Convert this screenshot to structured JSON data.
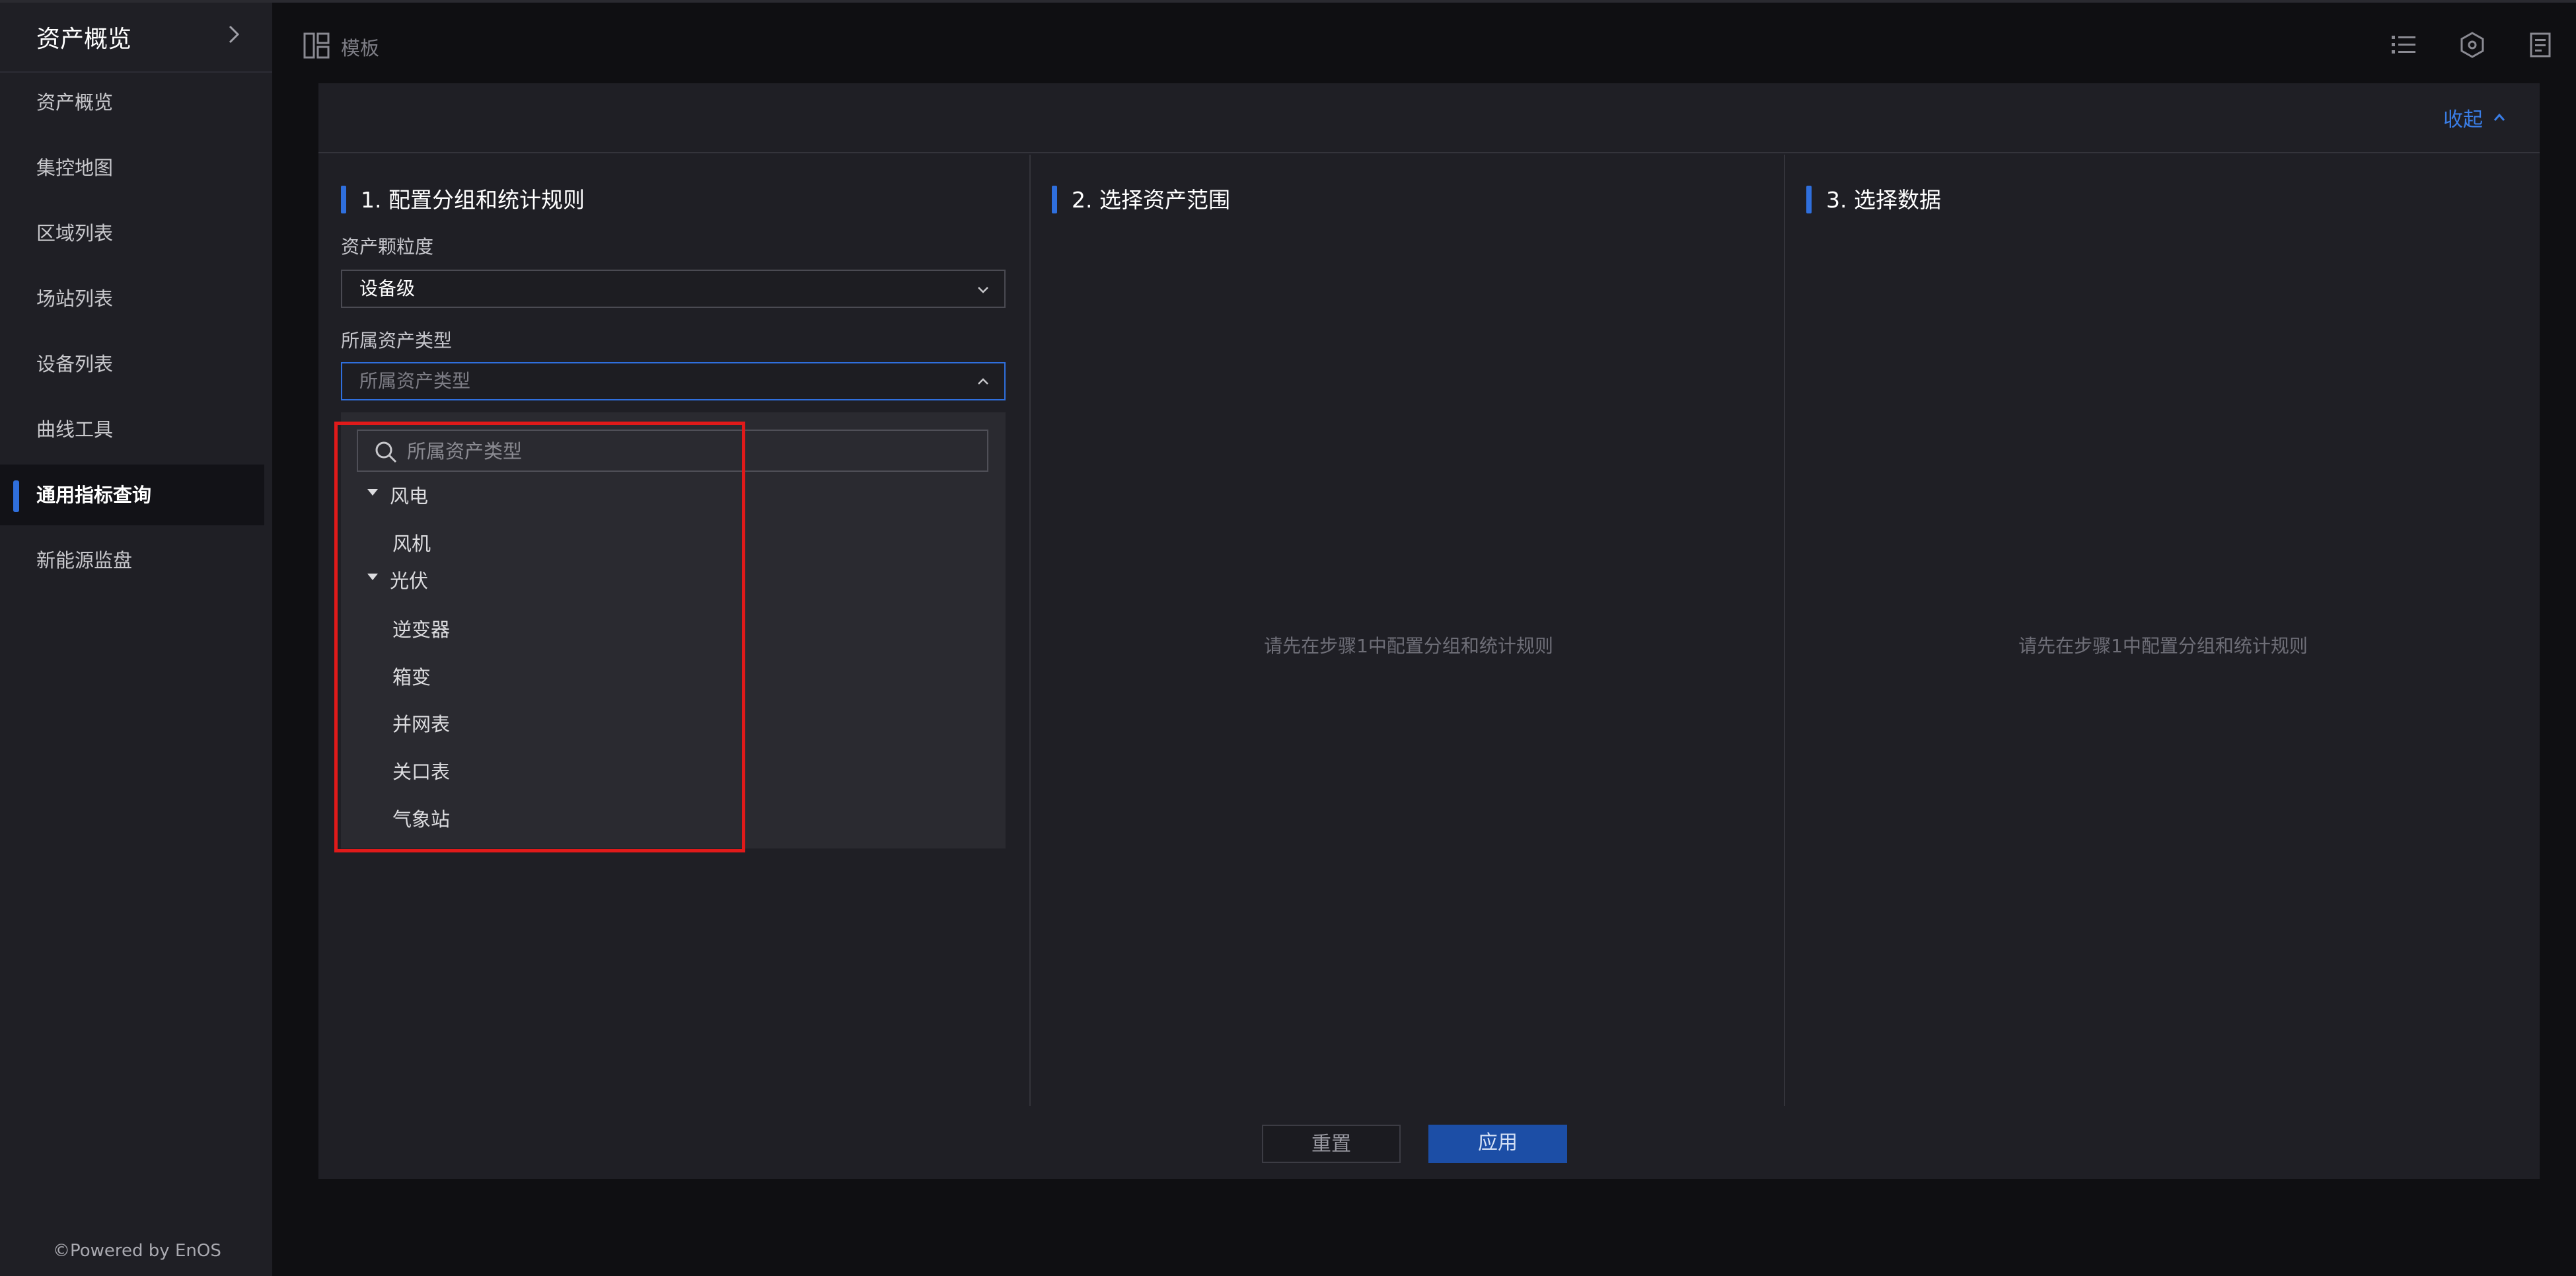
{
  "sidebar": {
    "title": "资产概览",
    "items": [
      {
        "label": "资产概览"
      },
      {
        "label": "集控地图"
      },
      {
        "label": "区域列表"
      },
      {
        "label": "场站列表"
      },
      {
        "label": "设备列表"
      },
      {
        "label": "曲线工具"
      },
      {
        "label": "通用指标查询",
        "active": true
      },
      {
        "label": "新能源监盘"
      }
    ],
    "footer": "©Powered by EnOS"
  },
  "header": {
    "template_label": "模板",
    "icons": [
      "list-icon",
      "hexagon-settings-icon",
      "document-icon"
    ]
  },
  "dialog": {
    "collapse_label": "收起",
    "step1": {
      "title": "1. 配置分组和统计规则",
      "granularity_label": "资产颗粒度",
      "granularity_value": "设备级",
      "asset_type_label": "所属资产类型",
      "asset_type_placeholder": "所属资产类型",
      "dropdown": {
        "search_placeholder": "所属资产类型",
        "groups": [
          {
            "label": "风电",
            "children": [
              "风机"
            ]
          },
          {
            "label": "光伏",
            "children": [
              "逆变器",
              "箱变",
              "并网表",
              "关口表",
              "气象站"
            ]
          }
        ]
      }
    },
    "step2": {
      "title": "2. 选择资产范围",
      "empty_text": "请先在步骤1中配置分组和统计规则"
    },
    "step3": {
      "title": "3. 选择数据",
      "empty_text": "请先在步骤1中配置分组和统计规则"
    },
    "buttons": {
      "reset": "重置",
      "apply": "应用"
    }
  },
  "colors": {
    "accent": "#2f6fdd",
    "highlight": "#e01a1a"
  }
}
